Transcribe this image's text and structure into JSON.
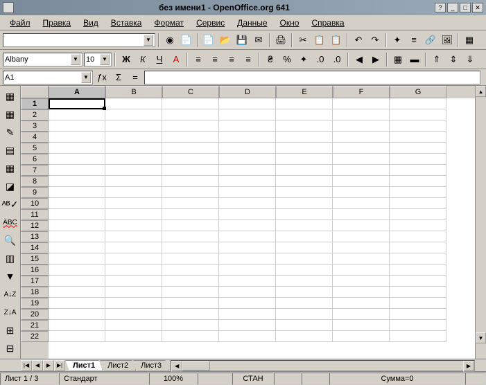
{
  "title": "без имени1  -  OpenOffice.org  641",
  "menu": [
    "Файл",
    "Правка",
    "Вид",
    "Вставка",
    "Формат",
    "Сервис",
    "Данные",
    "Окно",
    "Справка"
  ],
  "font": {
    "name": "Albany",
    "size": "10"
  },
  "format_labels": {
    "bold": "Ж",
    "italic": "К",
    "underline": "Ч",
    "font_color": "А"
  },
  "cell_ref": "A1",
  "columns": [
    "A",
    "B",
    "C",
    "D",
    "E",
    "F",
    "G"
  ],
  "rows": [
    1,
    2,
    3,
    4,
    5,
    6,
    7,
    8,
    9,
    10,
    11,
    12,
    13,
    14,
    15,
    16,
    17,
    18,
    19,
    20,
    21,
    22
  ],
  "active": {
    "col": "A",
    "row": 1
  },
  "sheets": [
    "Лист1",
    "Лист2",
    "Лист3"
  ],
  "active_sheet": 0,
  "status": {
    "sheet": "Лист 1 / 3",
    "style": "Стандарт",
    "zoom": "100%",
    "mode": "СТАН",
    "sum": "Сумма=0"
  }
}
